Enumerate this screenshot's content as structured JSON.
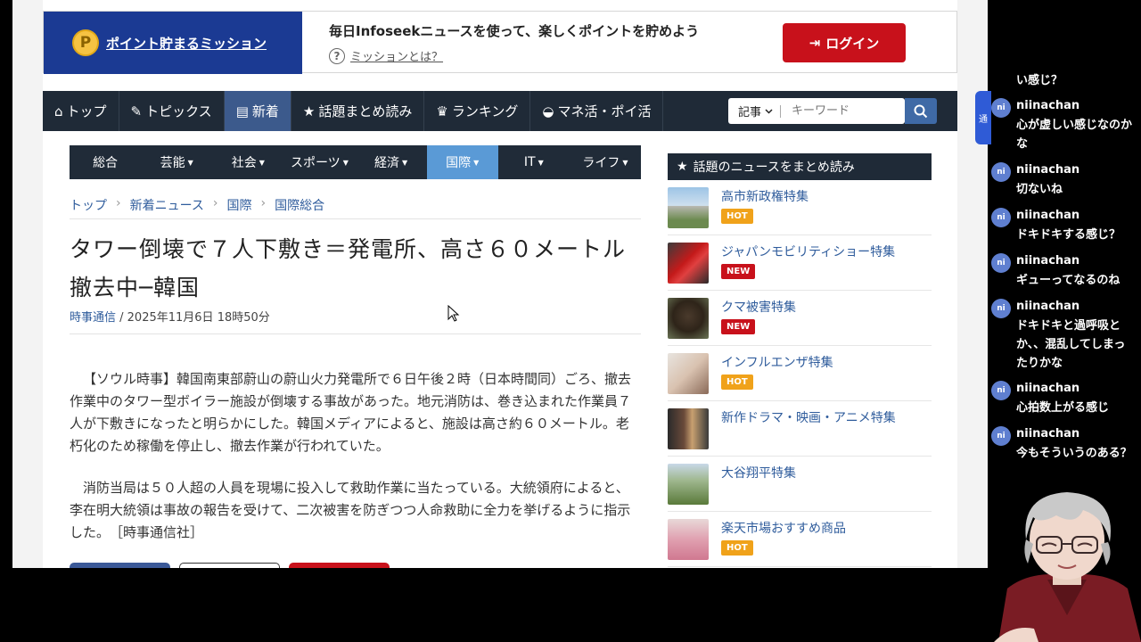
{
  "mission": {
    "coin_symbol": "P",
    "link": "ポイント貯まるミッション",
    "text": "毎日Infoseekニュースを使って、楽しくポイントを貯めよう",
    "help_icon": "?",
    "help": "ミッションとは？",
    "login_icon": "⇥",
    "login": "ログイン"
  },
  "mainnav": {
    "items": [
      {
        "icon": "⌂",
        "label": "トップ"
      },
      {
        "icon": "✎",
        "label": "トピックス"
      },
      {
        "icon": "▤",
        "label": "新着"
      },
      {
        "icon": "★",
        "label": "話題まとめ読み"
      },
      {
        "icon": "♛",
        "label": "ランキング"
      },
      {
        "icon": "◒",
        "label": "マネ活・ポイ活"
      }
    ],
    "search_category": "記事",
    "search_placeholder": "キーワード"
  },
  "catnav": {
    "items": [
      "総合",
      "芸能",
      "社会",
      "スポーツ",
      "経済",
      "国際",
      "IT",
      "ライフ"
    ],
    "caret": "▼"
  },
  "breadcrumb": {
    "items": [
      "トップ",
      "新着ニュース",
      "国際",
      "国際総合"
    ],
    "sep": "›"
  },
  "article": {
    "headline": "タワー倒壊で７人下敷き＝発電所、高さ６０メートル撤去中─韓国",
    "source": "時事通信",
    "date": " / 2025年11月6日 18時50分",
    "p1": "【ソウル時事】韓国南東部蔚山の蔚山火力発電所で６日午後２時（日本時間同）ごろ、撤去作業中のタワー型ボイラー施設が倒壊する事故があった。地元消防は、巻き込まれた作業員７人が下敷きになったと明らかにした。韓国メディアによると、施設は高さ約６０メートル。老朽化のため稼働を停止し、撤去作業が行われていた。",
    "p2": "消防当局は５０人超の人員を現場に投入して救助作業に当たっている。大統領府によると、李在明大統領は事故の報告を受けて、二次被害を防ぎつつ人命救助に全力を挙げるように指示した。　［時事通信社］"
  },
  "sidebar": {
    "heading_icon": "★",
    "heading": "話題のニュースをまとめ読み",
    "items": [
      {
        "title": "高市新政権特集",
        "badge": "HOT"
      },
      {
        "title": "ジャパンモビリティショー特集",
        "badge": "NEW"
      },
      {
        "title": "クマ被害特集",
        "badge": "NEW"
      },
      {
        "title": "インフルエンザ特集",
        "badge": "HOT"
      },
      {
        "title": "新作ドラマ・映画・アニメ特集",
        "badge": ""
      },
      {
        "title": "大谷翔平特集",
        "badge": ""
      },
      {
        "title": "楽天市場おすすめ商品",
        "badge": "HOT"
      }
    ]
  },
  "chat": {
    "tab": "通",
    "avatar_label": "ni",
    "first_line": "い感じ？",
    "messages": [
      {
        "name": "niinachan",
        "text": "心が虚しい感じなのかな"
      },
      {
        "name": "niinachan",
        "text": "切ないね"
      },
      {
        "name": "niinachan",
        "text": "ドキドキする感じ？"
      },
      {
        "name": "niinachan",
        "text": "ギューってなるのね"
      },
      {
        "name": "niinachan",
        "text": "ドキドキと過呼吸とか、、混乱してしまったりかな"
      },
      {
        "name": "niinachan",
        "text": "心拍数上がる感じ"
      },
      {
        "name": "niinachan",
        "text": "今もそういうのある？"
      }
    ]
  },
  "colors": {
    "nav_bg": "#1f2a37",
    "accent_blue": "#3c5a8c",
    "login_red": "#c8111b",
    "hot": "#f0a21a",
    "new": "#c8111b"
  }
}
